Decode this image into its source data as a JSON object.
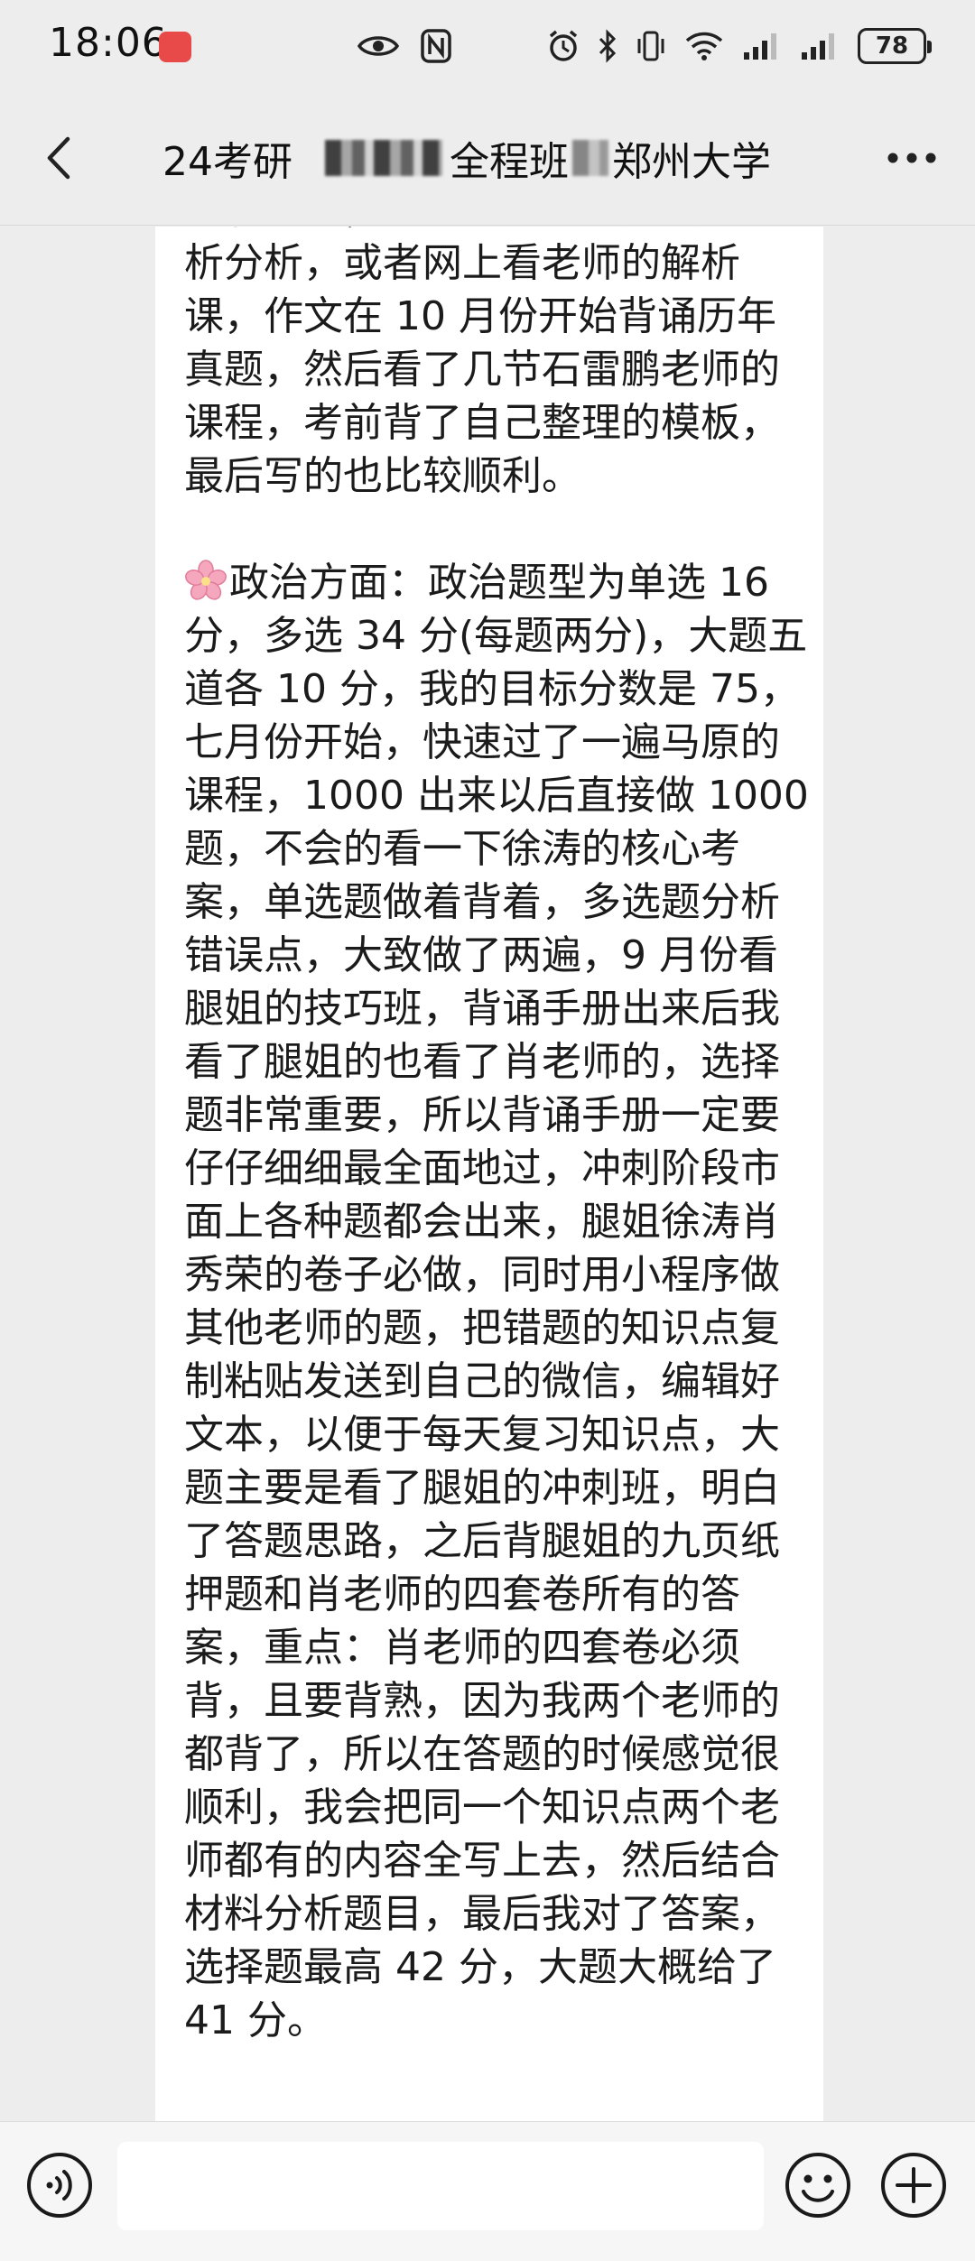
{
  "status_bar": {
    "time": "18:06",
    "battery": "78"
  },
  "header": {
    "title_prefix": "24考研",
    "title_middle": "全程班",
    "title_suffix": "郑州大学"
  },
  "message": {
    "lines": [
      "没有看课，自己做然后看黄皮书解",
      "析分析，或者网上看老师的解析",
      "课，作文在 10 月份开始背诵历年",
      "真题，然后看了几节石雷鹏老师的",
      "课程，考前背了自己整理的模板，",
      "最后写的也比较顺利。",
      "",
      "政治方面：政治题型为单选 16",
      "分，多选 34 分(每题两分)，大题五",
      "道各 10 分，我的目标分数是 75，",
      "七月份开始，快速过了一遍马原的",
      "课程，1000 出来以后直接做 1000",
      "题，不会的看一下徐涛的核心考",
      "案，单选题做着背着，多选题分析",
      "错误点，大致做了两遍，9 月份看",
      "腿姐的技巧班，背诵手册出来后我",
      "看了腿姐的也看了肖老师的，选择",
      "题非常重要，所以背诵手册一定要",
      "仔仔细细最全面地过，冲刺阶段市",
      "面上各种题都会出来，腿姐徐涛肖",
      "秀荣的卷子必做，同时用小程序做",
      "其他老师的题，把错题的知识点复",
      "制粘贴发送到自己的微信，编辑好",
      "文本，以便于每天复习知识点，大",
      "题主要是看了腿姐的冲刺班，明白",
      "了答题思路，之后背腿姐的九页纸",
      "押题和肖老师的四套卷所有的答",
      "案，重点：肖老师的四套卷必须",
      "背，且要背熟，因为我两个老师的",
      "都背了，所以在答题的时候感觉很",
      "顺利，我会把同一个知识点两个老",
      "师都有的内容全写上去，然后结合",
      "材料分析题目，最后我对了答案，",
      "选择题最高 42 分，大题大概给了",
      "41 分。"
    ]
  },
  "icons": {
    "back": "chevron-left-icon",
    "more": "more-dots-icon",
    "voice": "voice-icon",
    "emoji": "emoji-icon",
    "add": "plus-icon",
    "flower": "cherry-blossom-icon"
  }
}
